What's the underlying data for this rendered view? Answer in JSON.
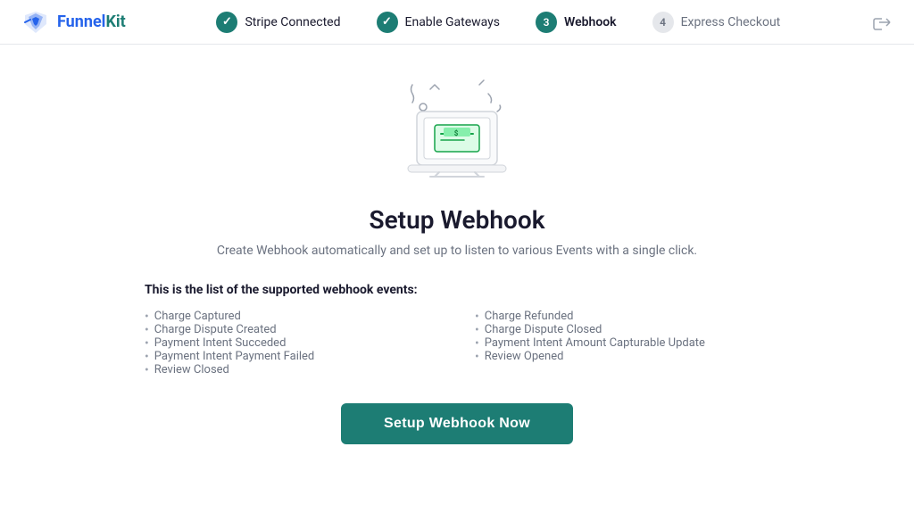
{
  "header": {
    "logo_text_part1": "Funnel",
    "logo_text_part2": "Kit",
    "exit_icon": "exit-icon"
  },
  "steps": [
    {
      "id": 1,
      "label": "Stripe Connected",
      "status": "completed",
      "number": "✓"
    },
    {
      "id": 2,
      "label": "Enable Gateways",
      "status": "completed",
      "number": "✓"
    },
    {
      "id": 3,
      "label": "Webhook",
      "status": "active",
      "number": "3"
    },
    {
      "id": 4,
      "label": "Express Checkout",
      "status": "inactive",
      "number": "4"
    }
  ],
  "page": {
    "title": "Setup Webhook",
    "subtitle": "Create Webhook automatically and set up to listen to various Events with a single click.",
    "events_title": "This is the list of the supported webhook events:",
    "events_col1": [
      "Charge Captured",
      "Charge Dispute Created",
      "Payment Intent Succeded",
      "Payment Intent Payment Failed",
      "Review Closed"
    ],
    "events_col2": [
      "Charge Refunded",
      "Charge Dispute Closed",
      "Payment Intent Amount Capturable Update",
      "Review Opened"
    ],
    "button_label": "Setup Webhook Now"
  }
}
